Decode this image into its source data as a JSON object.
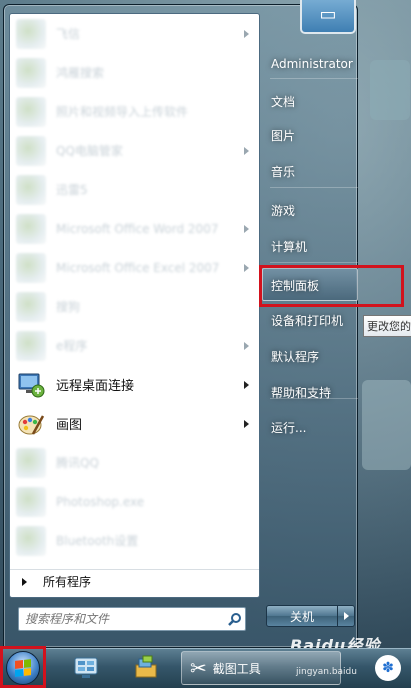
{
  "start_menu": {
    "programs": [
      {
        "label": "飞信",
        "blurred": true,
        "arrow": true,
        "icon": "app-icon"
      },
      {
        "label": "鸿雁搜索",
        "blurred": true,
        "arrow": false,
        "icon": "app-icon"
      },
      {
        "label": "照片和视频导入上传软件",
        "blurred": true,
        "arrow": false,
        "icon": "app-icon"
      },
      {
        "label": "QQ电脑管家",
        "blurred": true,
        "arrow": true,
        "icon": "app-icon"
      },
      {
        "label": "迅雷5",
        "blurred": true,
        "arrow": false,
        "icon": "app-icon"
      },
      {
        "label": "Microsoft Office Word 2007",
        "blurred": true,
        "arrow": true,
        "icon": "word-icon"
      },
      {
        "label": "Microsoft Office Excel 2007",
        "blurred": true,
        "arrow": true,
        "icon": "excel-icon"
      },
      {
        "label": "搜狗",
        "blurred": true,
        "arrow": false,
        "icon": "app-icon"
      },
      {
        "label": "e程序",
        "blurred": true,
        "arrow": true,
        "icon": "app-icon"
      },
      {
        "label": "远程桌面连接",
        "blurred": false,
        "arrow": true,
        "icon": "remote-desktop-icon"
      },
      {
        "label": "画图",
        "blurred": false,
        "arrow": true,
        "icon": "paint-icon"
      },
      {
        "label": "腾讯QQ",
        "blurred": true,
        "arrow": false,
        "icon": "app-icon"
      },
      {
        "label": "Photoshop.exe",
        "blurred": true,
        "arrow": false,
        "icon": "app-icon"
      },
      {
        "label": "Bluetooth设置",
        "blurred": true,
        "arrow": false,
        "icon": "app-icon"
      }
    ],
    "all_programs_label": "所有程序",
    "search_placeholder": "搜索程序和文件",
    "right_items": [
      {
        "label": "Administrator"
      },
      {
        "label": "文档"
      },
      {
        "label": "图片"
      },
      {
        "label": "音乐"
      },
      {
        "label": "游戏"
      },
      {
        "label": "计算机"
      },
      {
        "label": "控制面板"
      },
      {
        "label": "设备和打印机"
      },
      {
        "label": "默认程序"
      },
      {
        "label": "帮助和支持"
      },
      {
        "label": "运行..."
      }
    ],
    "tooltip": "更改您的",
    "shutdown_label": "关机"
  },
  "taskbar": {
    "app_label": "截图工具"
  },
  "watermark": {
    "brand": "Baidu经验",
    "url": "jingyan.baidu"
  },
  "colors": {
    "highlight": "#d2121d",
    "pane_bg": "#ffffff"
  }
}
